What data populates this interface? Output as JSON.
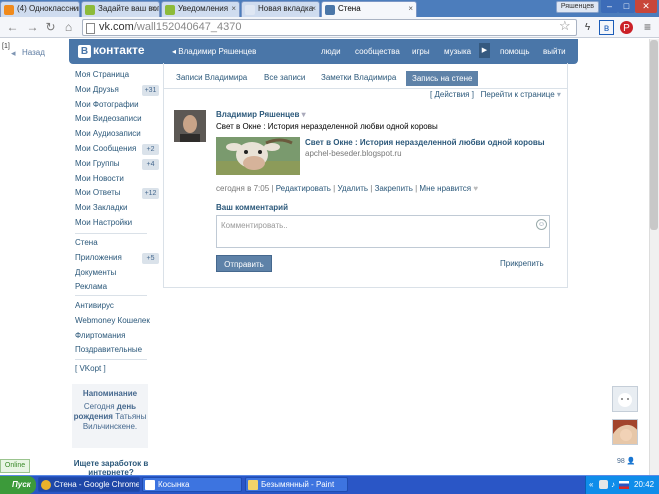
{
  "browser": {
    "tabs": [
      {
        "title": "(4) Одноклассники",
        "color": "#f08a1c"
      },
      {
        "title": "Задайте ваш вопрос",
        "color": "#8dbb3a"
      },
      {
        "title": "Уведомления",
        "color": "#8dbb3a"
      },
      {
        "title": "Новая вкладка",
        "color": "#dfe7f3"
      },
      {
        "title": "Стена",
        "color": "#4a76a8"
      }
    ],
    "user_chip": "Ряшенцев",
    "url_host": "vk.com",
    "url_path": "/wall152040647_4370"
  },
  "page": {
    "bracket": "[1]",
    "back_label": "Назад",
    "vk_logo_letter": "В",
    "vk_logo_text": "контакте",
    "user_name": "Владимир Ряшенцев",
    "header_links": [
      "люди",
      "сообщества",
      "игры",
      "музыка",
      "помощь",
      "выйти"
    ],
    "menu_items": [
      {
        "label": "Моя Страница",
        "count": ""
      },
      {
        "label": "Мои Друзья",
        "count": "+31"
      },
      {
        "label": "Мои Фотографии",
        "count": ""
      },
      {
        "label": "Мои Видеозаписи",
        "count": ""
      },
      {
        "label": "Мои Аудиозаписи",
        "count": ""
      },
      {
        "label": "Мои Сообщения",
        "count": "+2"
      },
      {
        "label": "Мои Группы",
        "count": "+4"
      },
      {
        "label": "Мои Новости",
        "count": ""
      },
      {
        "label": "Мои Ответы",
        "count": "+12"
      },
      {
        "label": "Мои Закладки",
        "count": ""
      },
      {
        "label": "Мои Настройки",
        "count": ""
      }
    ],
    "menu_items2": [
      {
        "label": "Стена",
        "count": ""
      },
      {
        "label": "Приложения",
        "count": "+5"
      },
      {
        "label": "Документы",
        "count": ""
      },
      {
        "label": "Реклама",
        "count": ""
      }
    ],
    "menu_items3": [
      "Антивирус",
      "Webmoney Кошелек",
      "Флиртомания",
      "Поздравительные"
    ],
    "vkopt": "[ VKopt ]",
    "reminder_title": "Напоминание",
    "reminder_prefix": "Сегодня ",
    "reminder_bold": "день рождения",
    "reminder_rest": " Татьяны Вильчинскене.",
    "earn_text": "Ищете заработок в интернете?",
    "wall_tabs": [
      "Записи Владимира",
      "Все записи",
      "Заметки Владимира",
      "Запись на стене"
    ],
    "actions_link": "[ Действия ]",
    "goto_link": "Перейти к странице",
    "post": {
      "author": "Владимир Ряшенцев",
      "text": "Свет в Окне : История неразделенной любви одной коровы",
      "link_title": "Свет в Окне : История неразделенной любви одной коровы",
      "link_url": "apchel-beseder.blogspot.ru",
      "time": "сегодня в 7:05",
      "actions": [
        "Редактировать",
        "Удалить",
        "Закрепить",
        "Мне нравится"
      ]
    },
    "comment_title": "Ваш комментарий",
    "comment_placeholder": "Комментировать..",
    "send_label": "Отправить",
    "attach_label": "Прикрепить",
    "side_count": "98",
    "online_label": "Online"
  },
  "taskbar": {
    "start_label": "Пуск",
    "buttons": [
      "Стена - Google Chrome",
      "Косынка",
      "Безымянный - Paint"
    ],
    "clock": "20:42"
  }
}
